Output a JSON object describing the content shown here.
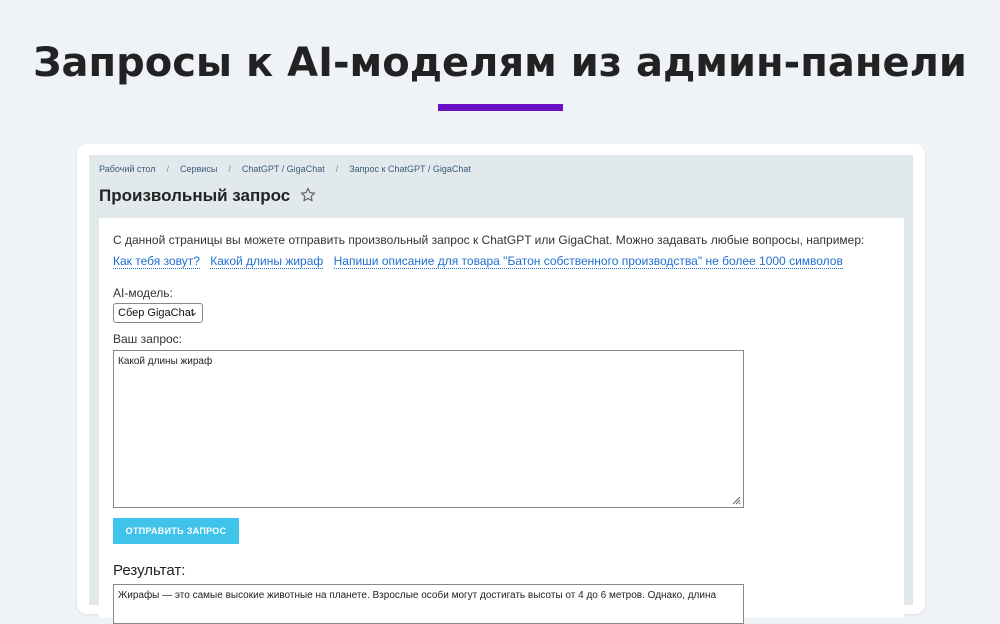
{
  "headline": "Запросы к AI-моделям из админ-панели",
  "colors": {
    "accent": "#6a0fc4",
    "send_button": "#3fc3ea",
    "link": "#1f6fd1",
    "admin_background": "#e2e9ec",
    "page_background": "#eff3f7"
  },
  "breadcrumb": [
    "Рабочий стол",
    "Сервисы",
    "ChatGPT / GigaChat",
    "Запрос к ChatGPT / GigaChat"
  ],
  "page": {
    "title": "Произвольный запрос",
    "favorite_icon": "star-outline-icon"
  },
  "intro_text": "С данной страницы вы можете отправить произвольный запрос к ChatGPT или GigaChat. Можно задавать любые вопросы, например:",
  "examples": [
    "Как тебя зовут?",
    "Какой длины жираф",
    "Напиши описание для товара \"Батон собственного производства\" не более 1000 символов"
  ],
  "model": {
    "label": "AI-модель:",
    "selected": "Сбер GigaChat"
  },
  "query": {
    "label": "Ваш запрос:",
    "value": "Какой длины жираф"
  },
  "send_label": "ОТПРАВИТЬ ЗАПРОС",
  "result": {
    "title": "Результат:",
    "text": "Жирафы — это самые высокие животные на планете. Взрослые особи могут достигать высоты от 4 до 6 метров. Однако, длина"
  }
}
